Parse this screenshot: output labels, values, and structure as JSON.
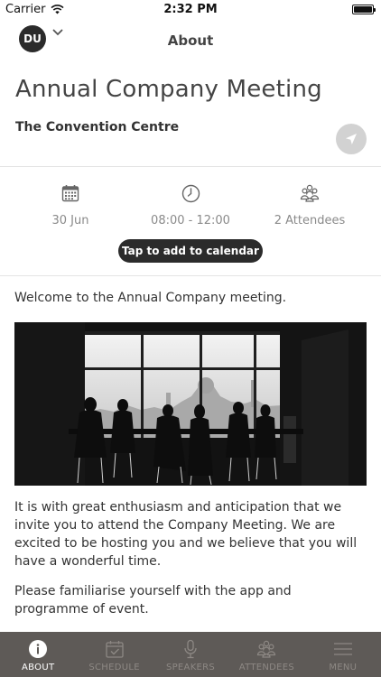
{
  "status_bar": {
    "carrier": "Carrier",
    "time": "2:32 PM"
  },
  "nav": {
    "avatar_initials": "DU",
    "title": "About"
  },
  "event": {
    "title": "Annual Company Meeting",
    "venue": "The Convention Centre",
    "date": "30 Jun",
    "time": "08:00 - 12:00",
    "attendees": "2 Attendees",
    "calendar_button": "Tap to add to calendar"
  },
  "content": {
    "welcome": "Welcome to the Annual Company meeting.",
    "paragraph_1": "It is with great enthusiasm and anticipation that we invite you to attend the Company Meeting. We are excited to be hosting you and we believe that you will have a wonderful time.",
    "paragraph_2": "Please familiarise yourself with the app and programme of event."
  },
  "tab_bar": {
    "items": [
      {
        "label": "ABOUT",
        "icon": "info-icon",
        "active": true
      },
      {
        "label": "SCHEDULE",
        "icon": "calendar-check-icon",
        "active": false
      },
      {
        "label": "SPEAKERS",
        "icon": "microphone-icon",
        "active": false
      },
      {
        "label": "ATTENDEES",
        "icon": "people-icon",
        "active": false
      },
      {
        "label": "MENU",
        "icon": "hamburger-icon",
        "active": false
      }
    ]
  },
  "colors": {
    "tab_bar_bg": "#5e5a57",
    "dark_button": "#2b2b2b",
    "muted_text": "#8a8a8a"
  }
}
